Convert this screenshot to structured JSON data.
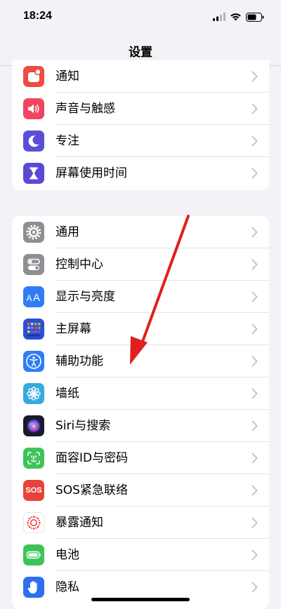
{
  "status_bar": {
    "time": "18:24"
  },
  "nav": {
    "title": "设置"
  },
  "group1": [
    {
      "label": "通知",
      "icon": "notification-icon",
      "color": "#ef4b42"
    },
    {
      "label": "声音与触感",
      "icon": "speaker-icon",
      "color": "#ef4560"
    },
    {
      "label": "专注",
      "icon": "moon-icon",
      "color": "#5b50d5"
    },
    {
      "label": "屏幕使用时间",
      "icon": "hourglass-icon",
      "color": "#5a4ad3"
    }
  ],
  "group2": [
    {
      "label": "通用",
      "icon": "gear-icon",
      "color": "#8e8e93"
    },
    {
      "label": "控制中心",
      "icon": "toggle-icon",
      "color": "#8e8e93"
    },
    {
      "label": "显示与亮度",
      "icon": "text-size-icon",
      "color": "#2f7cf6"
    },
    {
      "label": "主屏幕",
      "icon": "home-grid-icon",
      "color": "#2b4fd8"
    },
    {
      "label": "辅助功能",
      "icon": "accessibility-icon",
      "color": "#2f7cf6"
    },
    {
      "label": "墙纸",
      "icon": "flower-icon",
      "color": "#36aadc"
    },
    {
      "label": "Siri与搜索",
      "icon": "siri-icon",
      "color": "#1a1a2e"
    },
    {
      "label": "面容ID与密码",
      "icon": "face-id-icon",
      "color": "#3cc45a"
    },
    {
      "label": "SOS紧急联络",
      "icon": "sos-icon",
      "color": "#e8433a",
      "icon_text": "SOS"
    },
    {
      "label": "暴露通知",
      "icon": "exposure-icon",
      "color": "#ffffff"
    },
    {
      "label": "电池",
      "icon": "battery-icon",
      "color": "#3cc45a"
    },
    {
      "label": "隐私",
      "icon": "hand-icon",
      "color": "#2f6ff0"
    }
  ],
  "annotation": {
    "color": "#e0201e"
  }
}
